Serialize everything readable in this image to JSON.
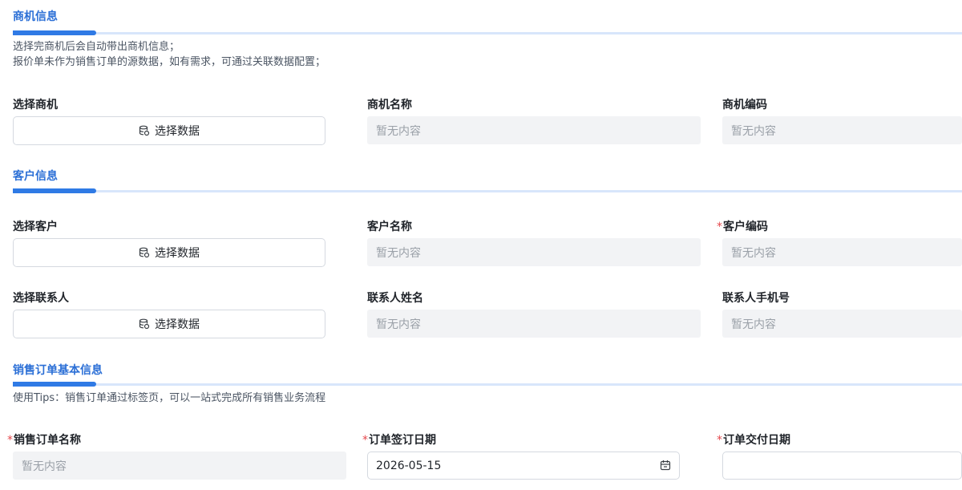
{
  "sections": {
    "opportunity": {
      "title": "商机信息",
      "desc_line1": "选择完商机后会自动带出商机信息；",
      "desc_line2": "报价单未作为销售订单的源数据，如有需求，可通过关联数据配置；"
    },
    "customer": {
      "title": "客户信息"
    },
    "order": {
      "title": "销售订单基本信息",
      "desc": "使用Tips：销售订单通过标签页，可以一站式完成所有销售业务流程"
    }
  },
  "fields": {
    "select_opportunity": {
      "label": "选择商机",
      "button": "选择数据"
    },
    "opportunity_name": {
      "label": "商机名称",
      "placeholder": "暂无内容"
    },
    "opportunity_code": {
      "label": "商机编码",
      "placeholder": "暂无内容"
    },
    "select_customer": {
      "label": "选择客户",
      "button": "选择数据"
    },
    "customer_name": {
      "label": "客户名称",
      "placeholder": "暂无内容"
    },
    "customer_code": {
      "label": "客户编码",
      "required_mark": "*",
      "placeholder": "暂无内容"
    },
    "select_contact": {
      "label": "选择联系人",
      "button": "选择数据"
    },
    "contact_name": {
      "label": "联系人姓名",
      "placeholder": "暂无内容"
    },
    "contact_phone": {
      "label": "联系人手机号",
      "placeholder": "暂无内容"
    },
    "order_name": {
      "label": "销售订单名称",
      "required_mark": "*",
      "placeholder": "暂无内容"
    },
    "sign_date": {
      "label": "订单签订日期",
      "required_mark": "*",
      "value": "2026-05-15"
    },
    "delivery_date": {
      "label": "订单交付日期",
      "required_mark": "*",
      "value": ""
    }
  },
  "icons": {
    "database": "database-icon",
    "calendar": "calendar-icon"
  },
  "colors": {
    "accent": "#2f7ae5",
    "required": "#e5484d"
  }
}
